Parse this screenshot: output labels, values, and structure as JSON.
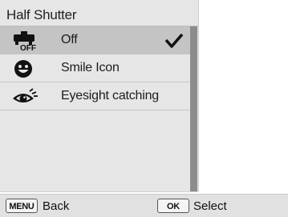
{
  "menu": {
    "title": "Half Shutter",
    "items": [
      {
        "label": "Off",
        "icon": "face-detection-off-icon",
        "selected": true
      },
      {
        "label": "Smile Icon",
        "icon": "smile-face-icon",
        "selected": false
      },
      {
        "label": "Eyesight catching",
        "icon": "eye-detection-icon",
        "selected": false
      }
    ]
  },
  "footer": {
    "menu_key": "MENU",
    "back_label": "Back",
    "ok_key": "OK",
    "select_label": "Select"
  },
  "colors": {
    "panel_bg": "#e6e6e6",
    "selected_row": "#c4c4c4",
    "scrollbar_thumb": "#8c8c8c"
  }
}
